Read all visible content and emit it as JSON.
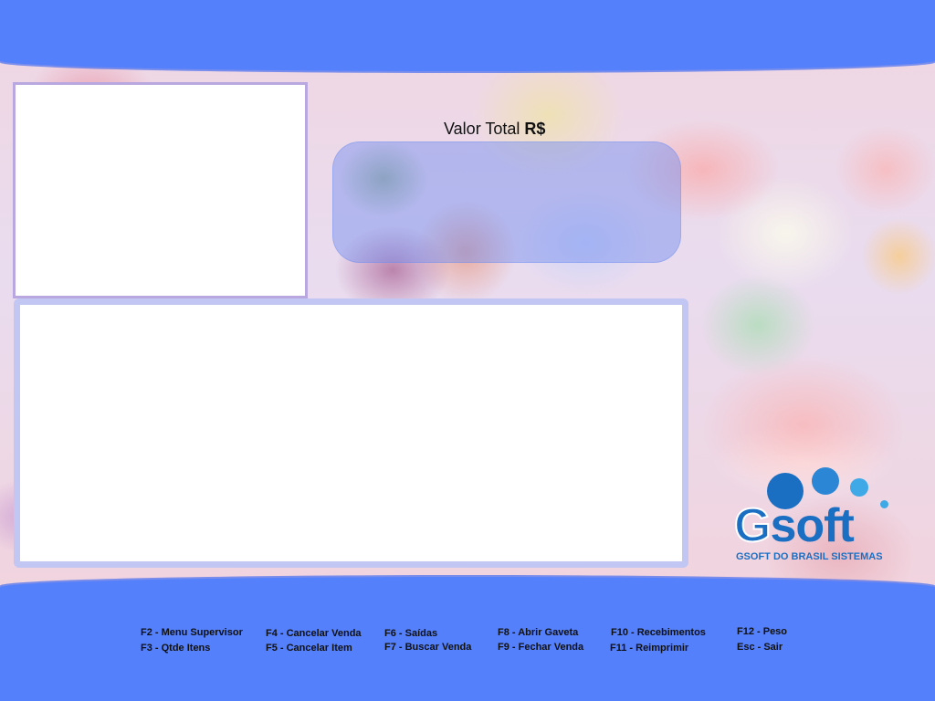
{
  "total": {
    "label": "Valor Total",
    "currency": "R$",
    "value": ""
  },
  "logo": {
    "text_g": "G",
    "text_soft": "soft",
    "caption": "GSOFT DO BRASIL SISTEMAS",
    "colors": {
      "primary": "#1b6fc3",
      "light": "#3fa8e6"
    }
  },
  "shortcuts": {
    "f2": "F2 - Menu Supervisor",
    "f3": "F3 - Qtde Itens",
    "f4": "F4 - Cancelar Venda",
    "f5": "F5 - Cancelar Item",
    "f6": "F6 - Saídas",
    "f7": "F7 - Buscar Venda",
    "f8": "F8 - Abrir Gaveta",
    "f9": "F9 - Fechar Venda",
    "f10": "F10 - Recebimentos",
    "f11": "F11 - Reimprimir",
    "f12": "F12 - Peso",
    "esc": "Esc - Sair"
  },
  "colors": {
    "band": "#5480fb",
    "panel_border": "#c2c6f3",
    "total_box": "#6e8cf0"
  }
}
